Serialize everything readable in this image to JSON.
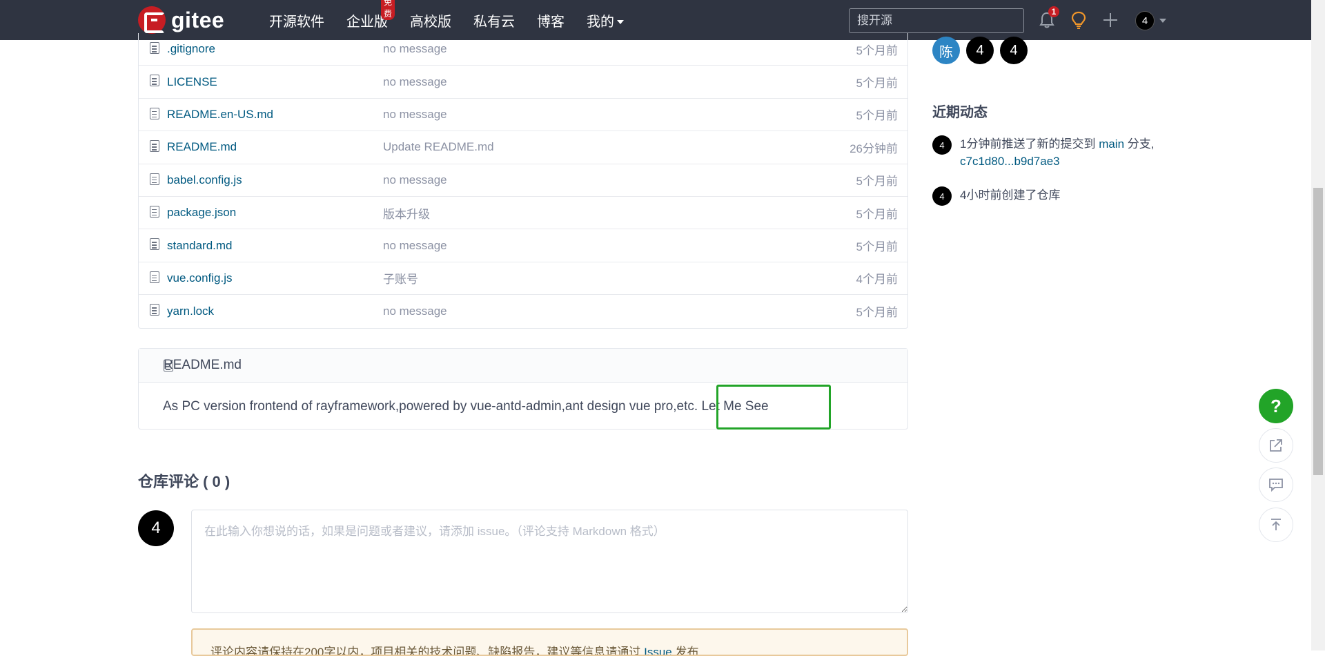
{
  "header": {
    "logo_text": "gitee",
    "nav": [
      {
        "label": "开源软件"
      },
      {
        "label": "企业版",
        "badge": "免费"
      },
      {
        "label": "高校版"
      },
      {
        "label": "私有云"
      },
      {
        "label": "博客"
      },
      {
        "label": "我的"
      }
    ],
    "search_placeholder": "搜开源",
    "notification_count": "1",
    "user_avatar": "4",
    "brand_color": "#c71d23"
  },
  "files": [
    {
      "name": ".gitignore",
      "message": "no message",
      "time": "5个月前"
    },
    {
      "name": "LICENSE",
      "message": "no message",
      "time": "5个月前"
    },
    {
      "name": "README.en-US.md",
      "message": "no message",
      "time": "5个月前"
    },
    {
      "name": "README.md",
      "message": "Update README.md",
      "time": "26分钟前"
    },
    {
      "name": "babel.config.js",
      "message": "no message",
      "time": "5个月前"
    },
    {
      "name": "package.json",
      "message": "版本升级",
      "time": "5个月前"
    },
    {
      "name": "standard.md",
      "message": "no message",
      "time": "5个月前"
    },
    {
      "name": "vue.config.js",
      "message": "子账号",
      "time": "4个月前"
    },
    {
      "name": "yarn.lock",
      "message": "no message",
      "time": "5个月前"
    }
  ],
  "readme": {
    "title": "README.md",
    "body": "As PC version frontend of rayframework,powered by vue-antd-admin,ant design vue pro,etc. Let Me See"
  },
  "comments": {
    "title": "仓库评论 ( 0 )",
    "avatar": "4",
    "placeholder": "在此输入你想说的话，如果是问题或者建议，请添加 issue。（评论支持 Markdown 格式）",
    "note_text": "评论内容请保持在200字以内，项目相关的技术问题、缺陷报告，建议等信息请通过 ",
    "note_link": "Issue",
    "note_suffix": " 发布"
  },
  "sidebar": {
    "members": [
      {
        "label": "陈",
        "color": "#2d85c4"
      },
      {
        "label": "4",
        "color": "#000000"
      },
      {
        "label": "4",
        "color": "#000000"
      }
    ],
    "activity_title": "近期动态",
    "activities": [
      {
        "avatar": "4",
        "text": "1分钟前推送了新的提交到 ",
        "branch": "main",
        "suffix": " 分支,",
        "commit": "c7c1d80...b9d7ae3"
      },
      {
        "avatar": "4",
        "text": "4小时前创建了仓库"
      }
    ]
  },
  "fab": {
    "help_label": "?"
  }
}
